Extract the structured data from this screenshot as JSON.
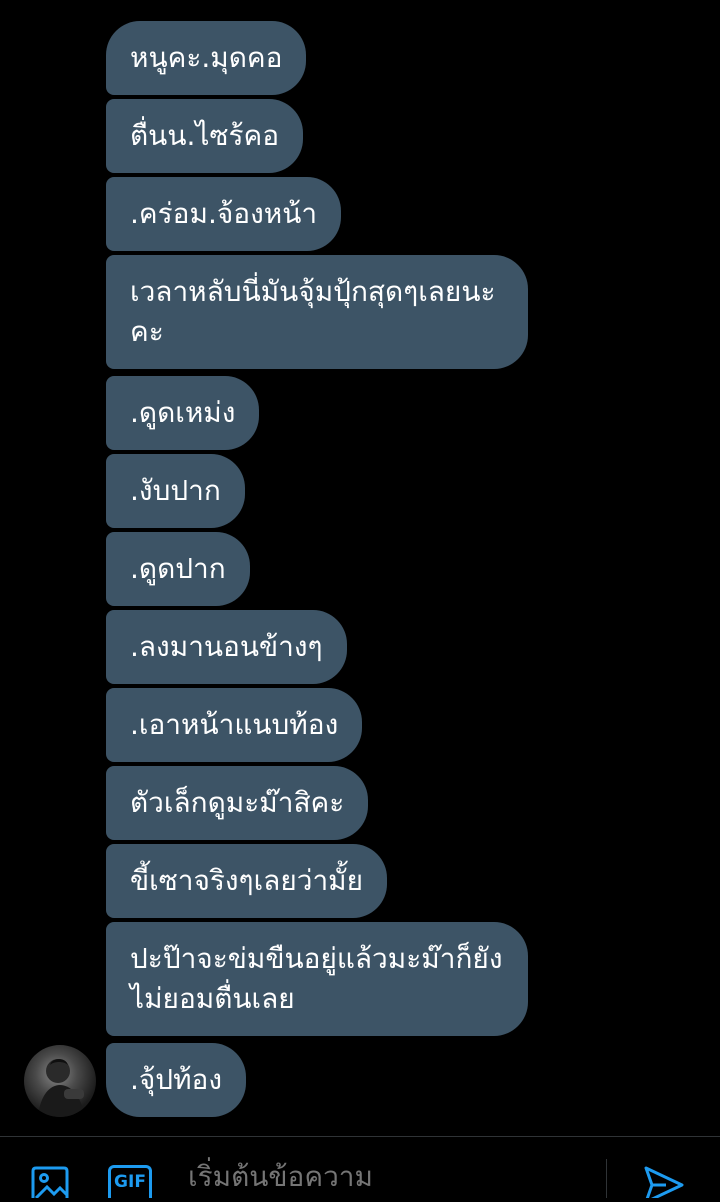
{
  "messages": [
    {
      "text": "หนูคะ.มุดคอ"
    },
    {
      "text": "ตื่นน.ไซร้คอ"
    },
    {
      "text": ".คร่อม.จ้องหน้า"
    },
    {
      "text": "เวลาหลับนี่มันจุ้มปุ้กสุดๆเลยนะคะ"
    },
    {
      "text": ".ดูดเหม่ง"
    },
    {
      "text": ".งับปาก"
    },
    {
      "text": ".ดูดปาก"
    },
    {
      "text": ".ลงมานอนข้างๆ"
    },
    {
      "text": ".เอาหน้าแนบท้อง"
    },
    {
      "text": "ตัวเล็กดูมะม๊าสิคะ"
    },
    {
      "text": "ขี้เซาจริงๆเลยว่ามั้ย"
    },
    {
      "text": "ปะป๊าจะข่มขืนอยู่แล้วมะม๊าก็ยังไม่ยอมตื่นเลย"
    },
    {
      "text": ".จุ้ปท้อง"
    }
  ],
  "composer": {
    "placeholder": "เริ่มต้นข้อความ",
    "gif_label": "GIF",
    "media_icon": "image-icon",
    "send_icon": "send-icon"
  },
  "colors": {
    "background": "#000000",
    "bubble": "#3d5466",
    "accent": "#1d9bf0",
    "placeholder": "#6e767d"
  }
}
